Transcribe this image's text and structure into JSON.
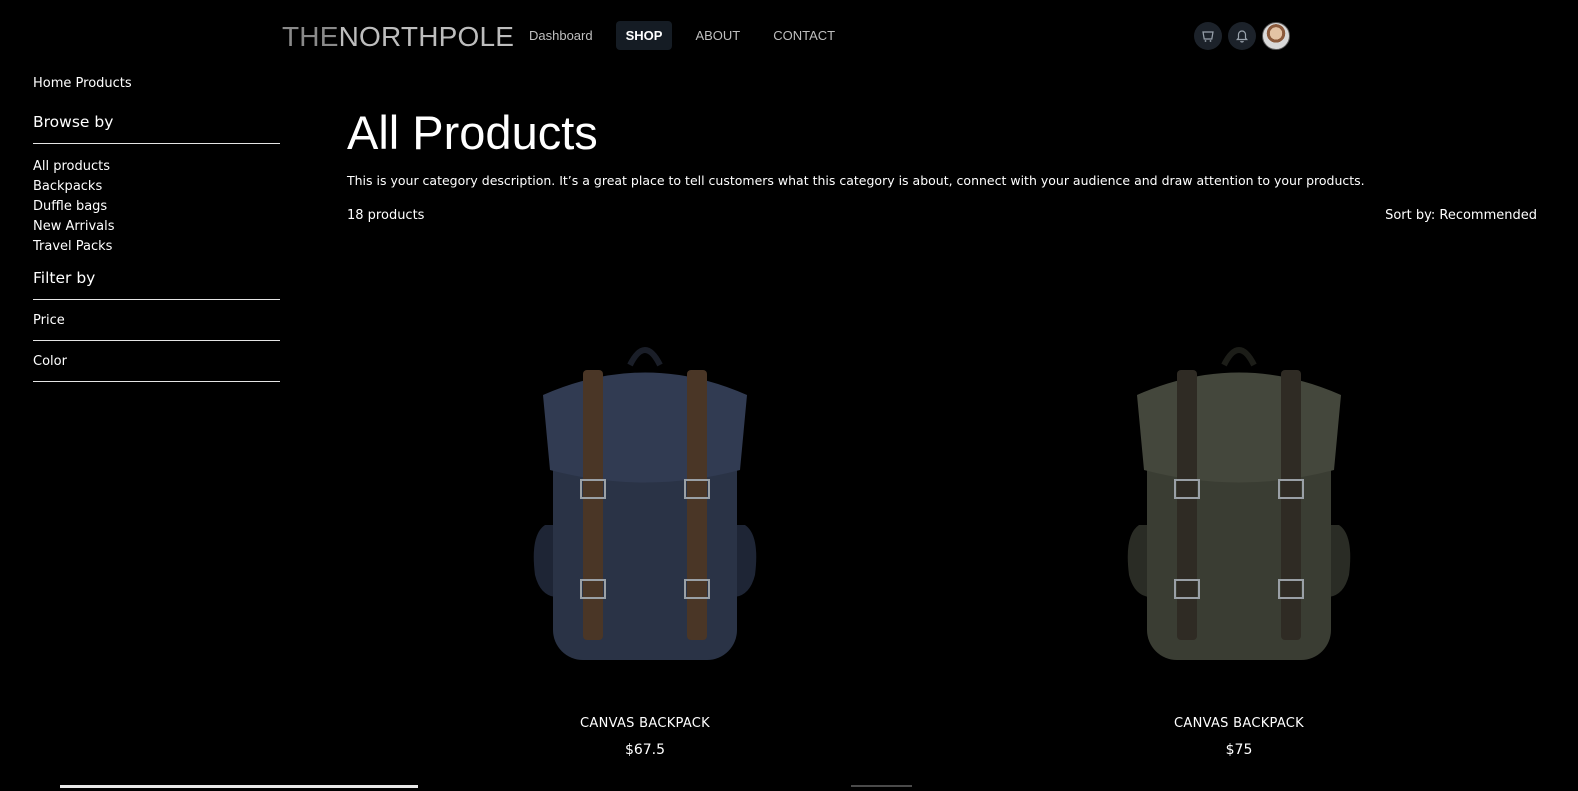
{
  "header": {
    "logo_the": "THE",
    "logo_np": "NORTHPOLE",
    "nav": [
      {
        "label": "Dashboard"
      },
      {
        "label": "SHOP"
      },
      {
        "label": "ABOUT"
      },
      {
        "label": "CONTACT"
      }
    ],
    "active_nav": "SHOP",
    "icons": [
      "cart-icon",
      "bell-icon",
      "avatar"
    ]
  },
  "sidebar": {
    "breadcrumb": "Home Products",
    "browse_title": "Browse by",
    "browse_items": [
      {
        "label": "All products"
      },
      {
        "label": "Backpacks"
      },
      {
        "label": "Duffle bags"
      },
      {
        "label": "New Arrivals"
      },
      {
        "label": "Travel Packs"
      }
    ],
    "filter_title": "Filter by",
    "filters": [
      {
        "label": "Price"
      },
      {
        "label": "Color"
      }
    ]
  },
  "main": {
    "title": "All Products",
    "description": "This is your category description. It’s a great place to tell customers what this category is about, connect with your audience and draw attention to your products.",
    "count": "18 products",
    "sort": "Sort by: Recommended"
  },
  "products": [
    {
      "name": "CANVAS BACKPACK",
      "price": "$67.5",
      "color": "#2a3346",
      "strap": "#4a3626"
    },
    {
      "name": "CANVAS BACKPACK",
      "price": "$75",
      "color": "#3a3d33",
      "strap": "#2f2b24"
    }
  ],
  "colors": {
    "background": "#000000",
    "text": "#ffffff",
    "nav_active_bg": "#151c24"
  }
}
